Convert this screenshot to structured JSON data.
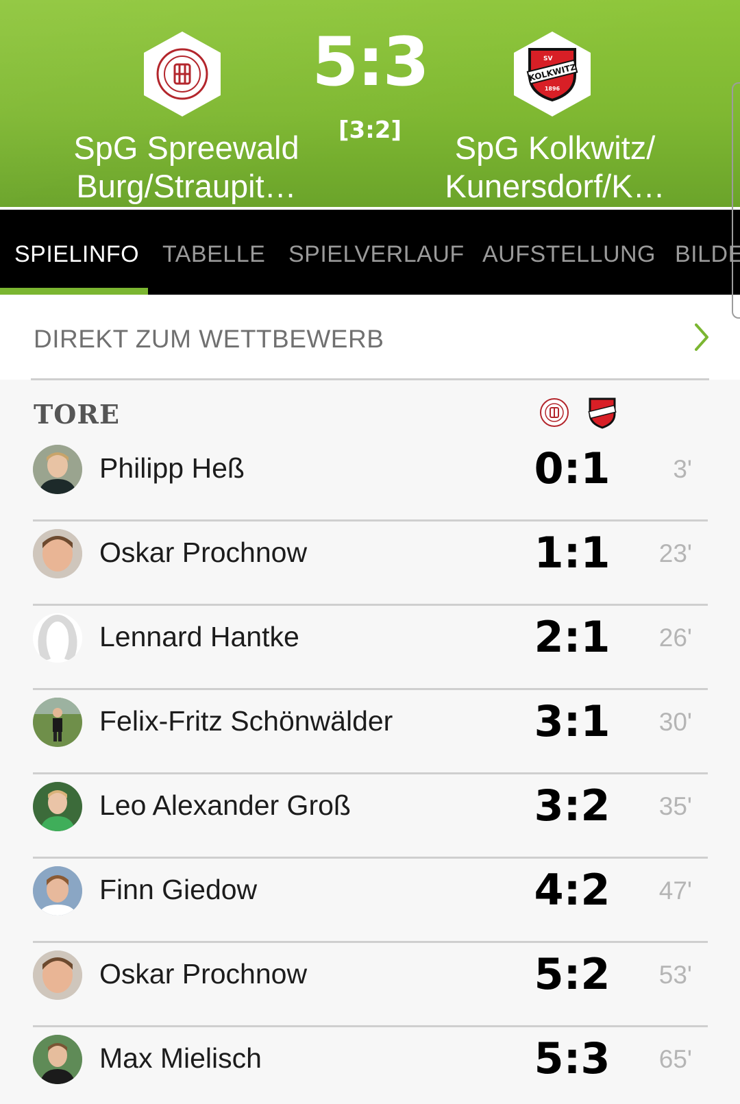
{
  "match": {
    "score": "5:3",
    "halftime": "[3:2]",
    "home": {
      "name_line1": "SpG Spreewald",
      "name_line2": "Burg/Straupit…",
      "logo": "sv-werben-crest-icon"
    },
    "away": {
      "name_line1": "SpG Kolkwitz/",
      "name_line2": "Kunersdorf/K…",
      "logo": "sv-kolkwitz-crest-icon"
    }
  },
  "tabs": [
    {
      "label": "SPIELINFO",
      "active": true
    },
    {
      "label": "TABELLE",
      "active": false
    },
    {
      "label": "SPIELVERLAUF",
      "active": false
    },
    {
      "label": "AUFSTELLUNG",
      "active": false
    },
    {
      "label": "BILDE",
      "active": false
    }
  ],
  "direct_link": {
    "label": "DIREKT ZUM WETTBEWERB",
    "icon": "chevron-right-icon"
  },
  "goals_section": {
    "title": "TORE",
    "goals": [
      {
        "player": "Philipp Heß",
        "score": "0:1",
        "minute": "3'",
        "avatar": "photo"
      },
      {
        "player": "Oskar Prochnow",
        "score": "1:1",
        "minute": "23'",
        "avatar": "photo"
      },
      {
        "player": "Lennard Hantke",
        "score": "2:1",
        "minute": "26'",
        "avatar": "placeholder"
      },
      {
        "player": "Felix-Fritz Schönwälder",
        "score": "3:1",
        "minute": "30'",
        "avatar": "photo"
      },
      {
        "player": "Leo Alexander Groß",
        "score": "3:2",
        "minute": "35'",
        "avatar": "photo"
      },
      {
        "player": "Finn Giedow",
        "score": "4:2",
        "minute": "47'",
        "avatar": "photo"
      },
      {
        "player": "Oskar Prochnow",
        "score": "5:2",
        "minute": "53'",
        "avatar": "photo"
      },
      {
        "player": "Max Mielisch",
        "score": "5:3",
        "minute": "65'",
        "avatar": "photo"
      }
    ]
  },
  "colors": {
    "accent_green": "#7bb631",
    "tabbar_bg": "#000000",
    "away_red": "#d81f26",
    "home_red": "#b3262c"
  }
}
